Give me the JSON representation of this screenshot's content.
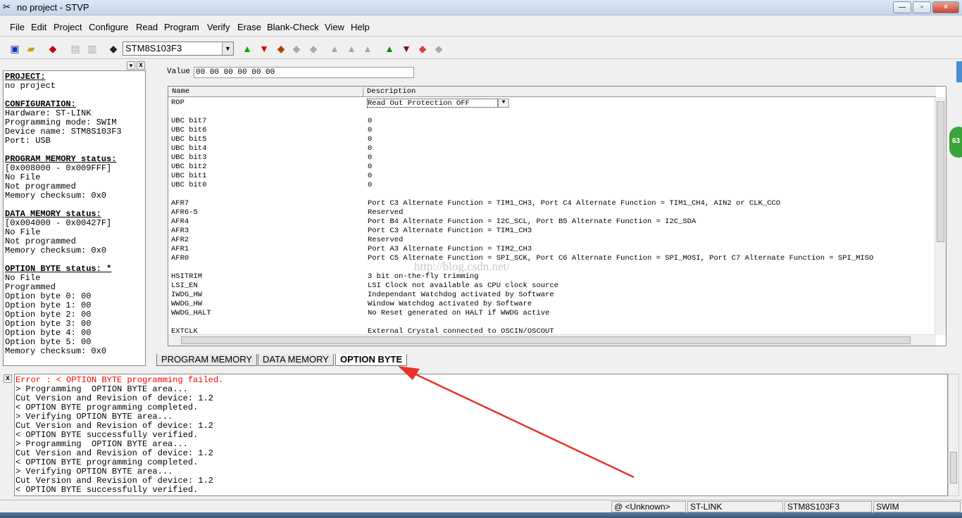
{
  "window": {
    "title": "no project - STVP",
    "min": "—",
    "max": "▫",
    "close": "✕"
  },
  "menu": [
    "File",
    "Edit",
    "Project",
    "Configure",
    "Read",
    "Program",
    "Verify",
    "Erase",
    "Blank-Check",
    "View",
    "Help"
  ],
  "toolbar": {
    "device": "STM8S103F3"
  },
  "left_panel": {
    "close": "x",
    "lines": [
      {
        "t": "PROJECT:",
        "h": true
      },
      {
        "t": "no project"
      },
      {
        "t": ""
      },
      {
        "t": "CONFIGURATION:",
        "h": true
      },
      {
        "t": "Hardware: ST-LINK"
      },
      {
        "t": "Programming mode: SWIM"
      },
      {
        "t": "Device name: STM8S103F3"
      },
      {
        "t": "Port: USB"
      },
      {
        "t": ""
      },
      {
        "t": "PROGRAM MEMORY status:",
        "h": true
      },
      {
        "t": "[0x008000 - 0x009FFF]"
      },
      {
        "t": "No File"
      },
      {
        "t": "Not programmed"
      },
      {
        "t": "Memory checksum: 0x0"
      },
      {
        "t": ""
      },
      {
        "t": "DATA MEMORY status:",
        "h": true
      },
      {
        "t": "[0x004000 - 0x00427F]"
      },
      {
        "t": "No File"
      },
      {
        "t": "Not programmed"
      },
      {
        "t": "Memory checksum: 0x0"
      },
      {
        "t": ""
      },
      {
        "t": "OPTION BYTE status: *",
        "h": true
      },
      {
        "t": "No File"
      },
      {
        "t": "Programmed"
      },
      {
        "t": "Option byte 0: 00"
      },
      {
        "t": "Option byte 1: 00"
      },
      {
        "t": "Option byte 2: 00"
      },
      {
        "t": "Option byte 3: 00"
      },
      {
        "t": "Option byte 4: 00"
      },
      {
        "t": "Option byte 5: 00"
      },
      {
        "t": "Memory checksum: 0x0"
      }
    ]
  },
  "option_editor": {
    "value_label": "Value",
    "value": "00 00 00 00 00 00",
    "col_name": "Name",
    "col_desc": "Description",
    "rows": [
      {
        "n": "ROP",
        "d": "Read Out Protection OFF",
        "select": true
      },
      {
        "n": "",
        "d": ""
      },
      {
        "n": "UBC bit7",
        "d": "0"
      },
      {
        "n": "UBC bit6",
        "d": "0"
      },
      {
        "n": "UBC bit5",
        "d": "0"
      },
      {
        "n": "UBC bit4",
        "d": "0"
      },
      {
        "n": "UBC bit3",
        "d": "0"
      },
      {
        "n": "UBC bit2",
        "d": "0"
      },
      {
        "n": "UBC bit1",
        "d": "0"
      },
      {
        "n": "UBC bit0",
        "d": "0"
      },
      {
        "n": "",
        "d": ""
      },
      {
        "n": "AFR7",
        "d": "Port C3 Alternate Function = TIM1_CH3, Port C4 Alternate Function = TIM1_CH4, AIN2 or CLK_CCO"
      },
      {
        "n": "AFR6-5",
        "d": "Reserved"
      },
      {
        "n": "AFR4",
        "d": "Port B4 Alternate Function = I2C_SCL, Port B5 Alternate Function = I2C_SDA"
      },
      {
        "n": "AFR3",
        "d": "Port C3 Alternate Function = TIM1_CH3"
      },
      {
        "n": "AFR2",
        "d": "Reserved"
      },
      {
        "n": "AFR1",
        "d": "Port A3 Alternate Function = TIM2_CH3"
      },
      {
        "n": "AFR0",
        "d": "Port C5 Alternate Function = SPI_SCK, Port C6 Alternate Function = SPI_MOSI, Port C7 Alternate Function = SPI_MISO"
      },
      {
        "n": "",
        "d": ""
      },
      {
        "n": "HSITRIM",
        "d": "3 bit on-the-fly trimming"
      },
      {
        "n": "LSI_EN",
        "d": "LSI Clock not available as CPU clock source"
      },
      {
        "n": "IWDG_HW",
        "d": "Independant Watchdog activated by Software"
      },
      {
        "n": "WWDG_HW",
        "d": "Window Watchdog activated by Software"
      },
      {
        "n": "WWDG_HALT",
        "d": "No Reset generated on HALT if WWDG active"
      },
      {
        "n": "",
        "d": ""
      },
      {
        "n": "EXTCLK",
        "d": "External Crystal connected to OSCIN/OSCOUT"
      }
    ]
  },
  "watermark": "http://blog.csdn.net/",
  "tabs": [
    "PROGRAM MEMORY",
    "DATA MEMORY",
    "OPTION BYTE"
  ],
  "log": {
    "close": "x",
    "lines": [
      {
        "t": "Error : < OPTION BYTE programming failed.",
        "err": true
      },
      {
        "t": "> Programming  OPTION BYTE area..."
      },
      {
        "t": "Cut Version and Revision of device: 1.2"
      },
      {
        "t": "< OPTION BYTE programming completed."
      },
      {
        "t": "> Verifying OPTION BYTE area..."
      },
      {
        "t": "Cut Version and Revision of device: 1.2"
      },
      {
        "t": "< OPTION BYTE successfully verified."
      },
      {
        "t": "> Programming  OPTION BYTE area..."
      },
      {
        "t": "Cut Version and Revision of device: 1.2"
      },
      {
        "t": "< OPTION BYTE programming completed."
      },
      {
        "t": "> Verifying OPTION BYTE area..."
      },
      {
        "t": "Cut Version and Revision of device: 1.2"
      },
      {
        "t": "< OPTION BYTE successfully verified."
      }
    ]
  },
  "status": {
    "address": "@ <Unknown>",
    "hardware": "ST-LINK",
    "device": "STM8S103F3",
    "mode": "SWIM"
  },
  "badge": "63",
  "colors": {
    "error": "#ff0000",
    "arrow": "#e8322a"
  }
}
